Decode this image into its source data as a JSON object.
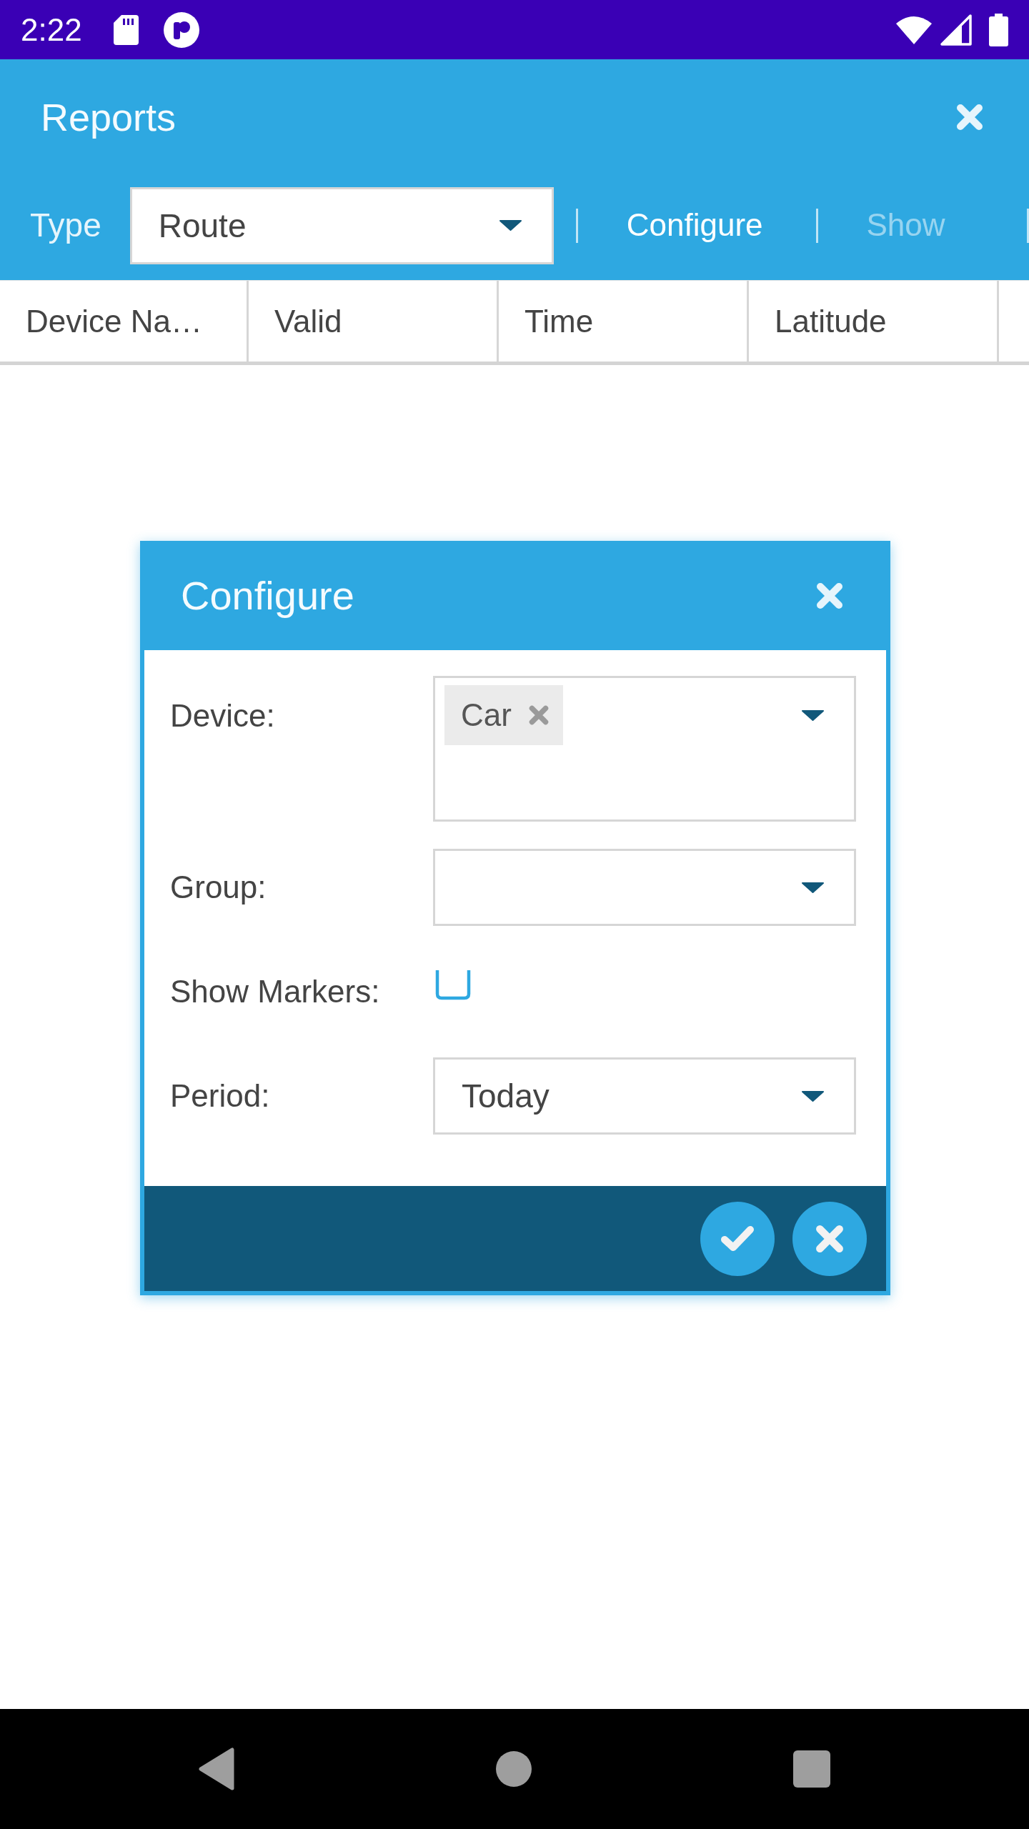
{
  "status_bar": {
    "time": "2:22"
  },
  "header": {
    "title": "Reports"
  },
  "toolbar": {
    "type_label": "Type",
    "type_select": {
      "value": "Route"
    },
    "actions": [
      {
        "label": "Configure",
        "disabled": false
      },
      {
        "label": "Show",
        "disabled": true
      }
    ]
  },
  "table": {
    "columns": [
      "Device Na…",
      "Valid",
      "Time",
      "Latitude"
    ]
  },
  "dialog": {
    "title": "Configure",
    "fields": [
      {
        "kind": "multiselect",
        "label": "Device:",
        "chips": [
          "Car"
        ]
      },
      {
        "kind": "select",
        "label": "Group:"
      },
      {
        "kind": "checkbox",
        "label": "Show Markers:",
        "checked": false
      },
      {
        "kind": "select",
        "label": "Period:",
        "value": "Today"
      }
    ]
  }
}
